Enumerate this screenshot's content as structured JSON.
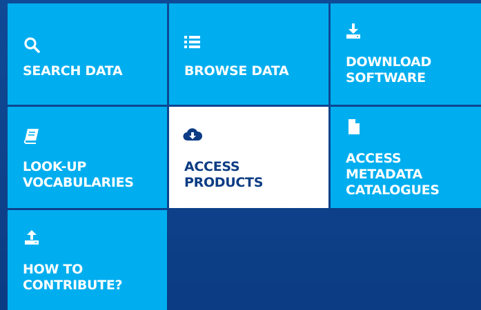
{
  "colors": {
    "tile": "#00aeef",
    "tile_active": "#ffffff",
    "text_on_tile": "#ffffff",
    "text_on_active": "#0c3c83",
    "background": "#0c3c83"
  },
  "tiles": [
    {
      "icon": "search-icon",
      "line1": "SEARCH DATA",
      "line2": "",
      "line3": ""
    },
    {
      "icon": "list-icon",
      "line1": "BROWSE DATA",
      "line2": "",
      "line3": ""
    },
    {
      "icon": "download-icon",
      "line1": "DOWNLOAD",
      "line2": "SOFTWARE",
      "line3": ""
    },
    {
      "icon": "book-icon",
      "line1": "LOOK-UP",
      "line2": "VOCABULARIES",
      "line3": ""
    },
    {
      "icon": "cloud-download-icon",
      "line1": "ACCESS",
      "line2": "PRODUCTS",
      "line3": "",
      "active": true
    },
    {
      "icon": "document-icon",
      "line1": "ACCESS",
      "line2": "METADATA",
      "line3": "CATALOGUES"
    },
    {
      "icon": "upload-icon",
      "line1": "HOW TO",
      "line2": "CONTRIBUTE?",
      "line3": ""
    }
  ]
}
